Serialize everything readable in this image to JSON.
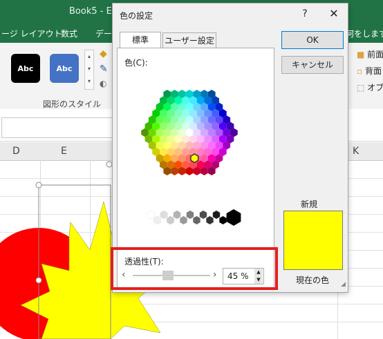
{
  "window": {
    "title": "Book5 - E"
  },
  "ribbon": {
    "tabs": [
      "ージ レイアウト",
      "数式",
      "デー",
      "何をしますか"
    ],
    "style_samples": [
      {
        "label": "Abc",
        "color": "#000000"
      },
      {
        "label": "Abc",
        "color": "#4472c4"
      }
    ],
    "right_items": [
      "前面",
      "背面",
      "オブ"
    ],
    "group_label": "図形のスタイル"
  },
  "columns": [
    "D",
    "E",
    "K"
  ],
  "dialog": {
    "title": "色の設定",
    "help": "?",
    "close": "✕",
    "tabs": [
      "標準",
      "ユーザー設定"
    ],
    "colors_label": "色(C):",
    "transparency_label": "透過性(T):",
    "transparency_value": "45 %",
    "transparency_fraction": 0.45,
    "ok": "OK",
    "cancel": "キャンセル",
    "new_label": "新規",
    "current_label": "現在の色",
    "selected_color": "#ffff00"
  },
  "shapes": {
    "sun_color": "#ffff00",
    "circle_color": "#ff0000"
  },
  "highlight_color": "#e2201e"
}
